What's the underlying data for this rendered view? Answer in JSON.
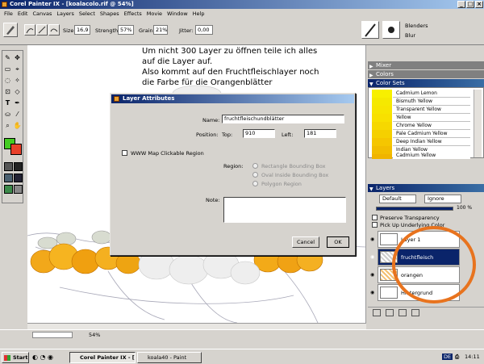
{
  "window": {
    "title": "Corel Painter IX - [koalacolo.rif @ 54%]"
  },
  "menu": [
    "File",
    "Edit",
    "Canvas",
    "Layers",
    "Select",
    "Shapes",
    "Effects",
    "Movie",
    "Window",
    "Help"
  ],
  "propbar": {
    "size_label": "Size:",
    "size_value": "16,9",
    "strength_label": "Strength:",
    "strength_value": "57%",
    "grain_label": "Grain:",
    "grain_value": "21%",
    "jitter_label": "Jitter:",
    "jitter_value": "0,00",
    "brush_category": "Blenders",
    "brush_variant": "Blur"
  },
  "note_text": {
    "line1": "Um nicht 300 Layer zu öffnen teile ich alles",
    "line2": "auf die Layer auf.",
    "line3": "Also kommt auf den Fruchtfleischlayer noch",
    "line4": "die Farbe für  die Orangenblätter"
  },
  "dialog": {
    "title": "Layer Attributes",
    "name_label": "Name:",
    "name_value": "fruchtfleischundblätter",
    "position_label": "Position:",
    "top_label": "Top:",
    "top_value": "910",
    "left_label": "Left:",
    "left_value": "181",
    "www_label": "WWW Map Clickable Region",
    "region_label": "Region:",
    "region_options": [
      "Rectangle Bounding Box",
      "Oval Inside Bounding Box",
      "Polygon Region"
    ],
    "note_label": "Note:",
    "cancel_label": "Cancel",
    "ok_label": "OK"
  },
  "panels": {
    "mixer_title": "Mixer",
    "colors_title": "Colors",
    "colorsets_title": "Color Sets",
    "color_names": [
      "Cadmium Lemon",
      "Bismuth Yellow",
      "Transparent Yellow",
      "Yellow",
      "Chrome Yellow",
      "Pale Cadmium Yellow",
      "Deep Indian Yellow",
      "Indian Yellow",
      "Cadmium Yellow"
    ],
    "color_swatches": [
      "#f7f000",
      "#f5e900",
      "#f7e500",
      "#f8e000",
      "#f6d800",
      "#f5d000",
      "#f5c600",
      "#f2bd00",
      "#f0b400"
    ],
    "layers_title": "Layers",
    "composite_method": "Default",
    "composite_depth": "Ignore",
    "opacity_value": "100 %",
    "preserve_label": "Preserve Transparency",
    "pickup_label": "Pick Up Underlying Color",
    "layers": [
      {
        "name": "Layer 1",
        "selected": false
      },
      {
        "name": "fruchtfleisch",
        "selected": true
      },
      {
        "name": "orangen",
        "selected": false
      },
      {
        "name": "Hintergrund",
        "selected": false
      }
    ]
  },
  "status": {
    "zoom": "54%"
  },
  "taskbar": {
    "start_label": "Start",
    "tasks": [
      "Corel Painter IX - [ko...",
      "koala40 - Paint"
    ],
    "language": "DE",
    "clock": "14:11"
  },
  "colors": {
    "title_blue": "#0a246a",
    "main_color": "#44cc22",
    "secondary_color": "#e8402a",
    "highlight_circle": "#e8731e"
  }
}
